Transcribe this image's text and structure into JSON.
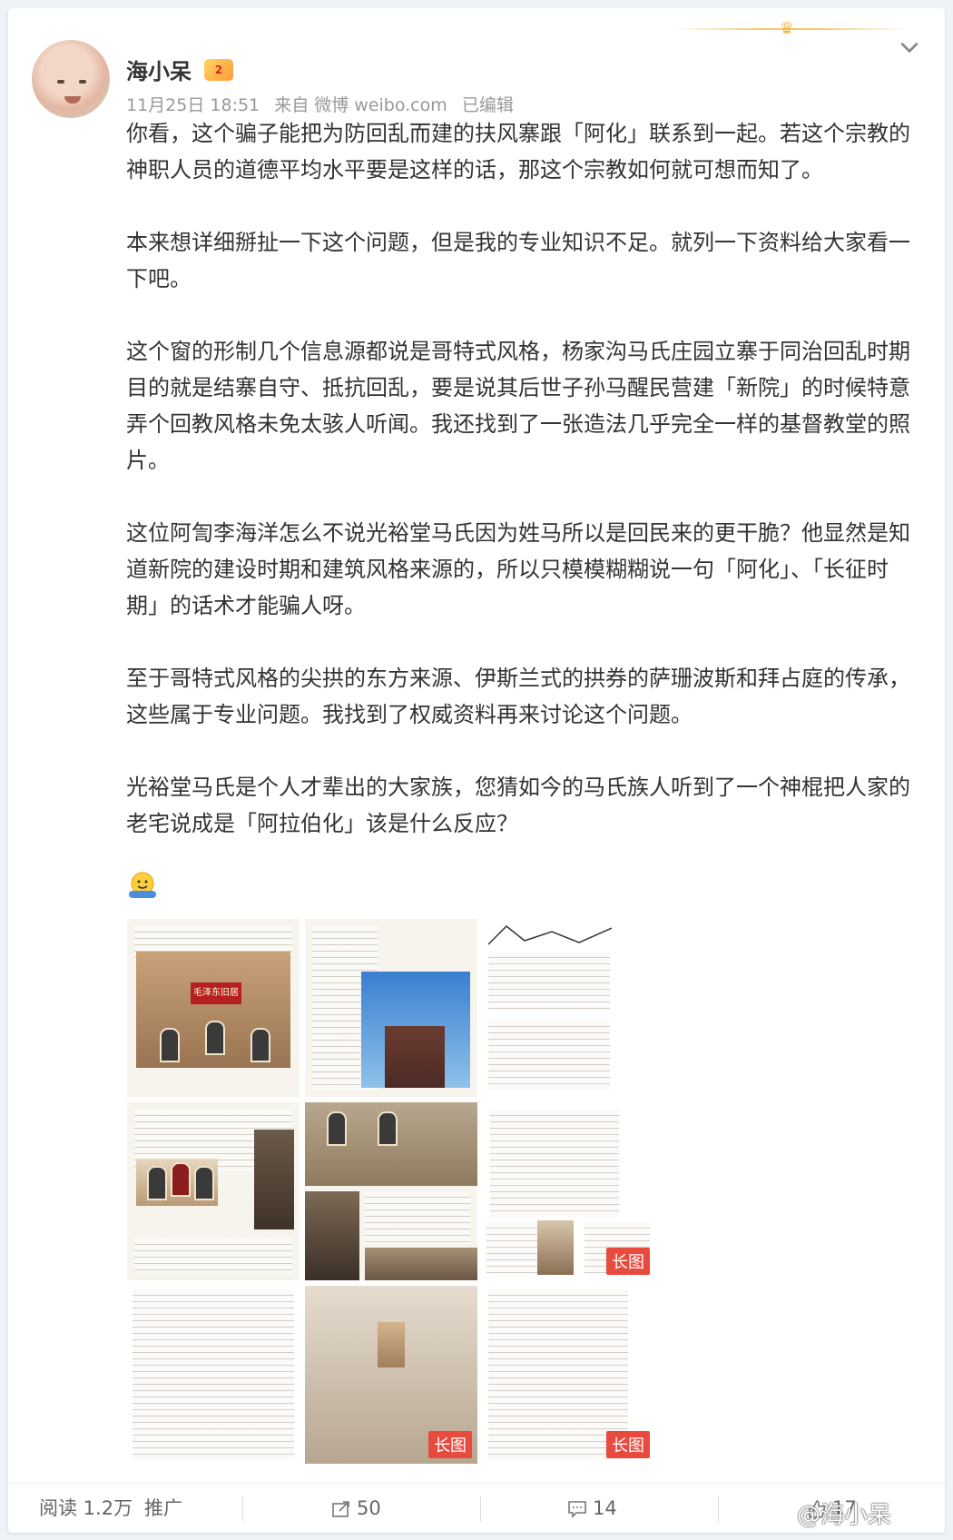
{
  "post": {
    "username": "海小呆",
    "vip_badge": "2",
    "date": "11月25日 18:51",
    "source": "来自 微博 weibo.com",
    "edited": "已编辑",
    "paragraphs": [
      "你看，这个骗子能把为防回乱而建的扶风寨跟「阿化」联系到一起。若这个宗教的神职人员的道德平均水平要是这样的话，那这个宗教如何就可想而知了。",
      "本来想详细掰扯一下这个问题，但是我的专业知识不足。就列一下资料给大家看一下吧。",
      "这个窗的形制几个信息源都说是哥特式风格，杨家沟马氏庄园立寨于同治回乱时期目的就是结寨自守、抵抗回乱，要是说其后世子孙马醒民营建「新院」的时候特意弄个回教风格未免太骇人听闻。我还找到了一张造法几乎完全一样的基督教堂的照片。",
      "这位阿訇李海洋怎么不说光裕堂马氏因为姓马所以是回民来的更干脆？他显然是知道新院的建设时期和建筑风格来源的，所以只模模糊糊说一句「阿化」、「长征时期」的话术才能骗人呀。",
      "至于哥特式风格的尖拱的东方来源、伊斯兰式的拱券的萨珊波斯和拜占庭的传承，这些属于专业问题。我找到了权威资料再来讨论这个问题。",
      "光裕堂马氏是个人才辈出的大家族，您猜如今的马氏族人听到了一个神棍把人家的老宅说成是「阿拉伯化」该是什么反应？"
    ],
    "images": [
      {
        "id": "img1",
        "type": "screenshot"
      },
      {
        "id": "img2",
        "type": "church"
      },
      {
        "id": "img3",
        "type": "doc-sketch"
      },
      {
        "id": "img4",
        "type": "doc-windows"
      },
      {
        "id": "img5",
        "type": "windows-photos"
      },
      {
        "id": "img6",
        "type": "doc-long",
        "badge": "长图"
      },
      {
        "id": "img7",
        "type": "doc-text"
      },
      {
        "id": "img8",
        "type": "room",
        "badge": "长图"
      },
      {
        "id": "img9",
        "type": "doc-text",
        "badge": "长图"
      }
    ]
  },
  "footer": {
    "reads": "阅读 1.2万",
    "promote": "推广",
    "reposts": "50",
    "comments": "14",
    "likes": "17"
  },
  "watermark": "@海小呆"
}
